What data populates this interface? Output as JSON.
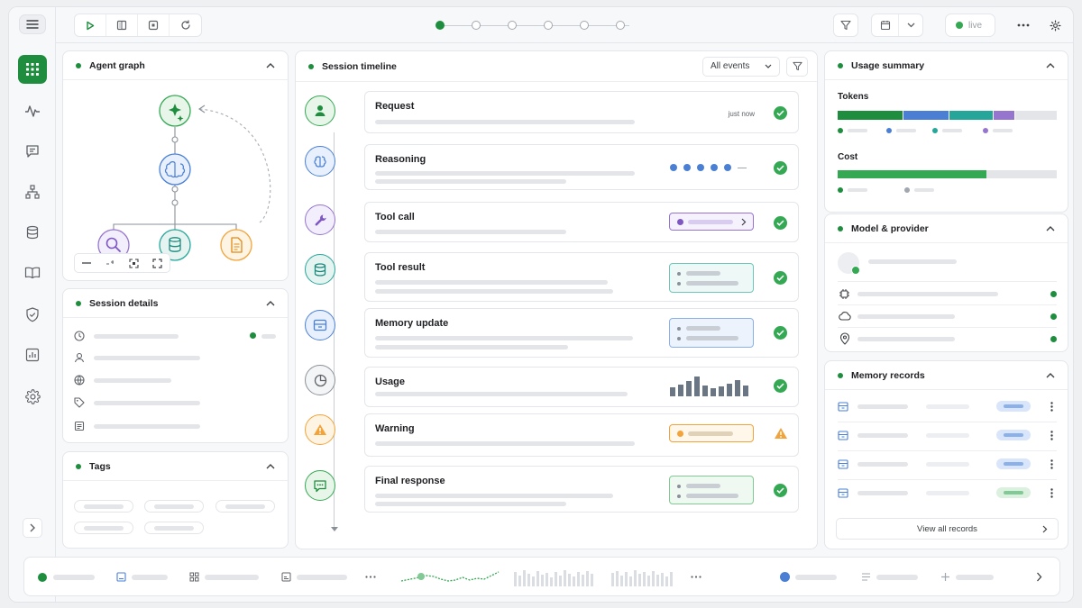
{
  "colors": {
    "green": "#1e8e3e",
    "blue": "#4a7fd4",
    "teal": "#26a69a",
    "purple": "#9575cd",
    "orange": "#f2a33a"
  },
  "sidebar": {
    "icons": [
      "apps-icon",
      "activity-icon",
      "chat-icon",
      "hierarchy-icon",
      "database-icon",
      "book-icon",
      "shield-icon",
      "report-icon",
      "gear-icon"
    ]
  },
  "topbar": {
    "live_label": "live",
    "progress_steps": 6,
    "active_step": 1
  },
  "agent_graph": {
    "title": "Agent graph"
  },
  "session_details": {
    "title": "Session details"
  },
  "tags": {
    "title": "Tags"
  },
  "timeline": {
    "title": "Session timeline",
    "filter_value": "All events",
    "events": [
      {
        "name": "Request",
        "status": "ok",
        "meta": "just now",
        "icon": "user-icon"
      },
      {
        "name": "Reasoning",
        "status": "ok",
        "icon": "brain-icon"
      },
      {
        "name": "Tool call",
        "status": "ok",
        "icon": "wrench-icon"
      },
      {
        "name": "Tool result",
        "status": "ok",
        "icon": "database-icon"
      },
      {
        "name": "Memory update",
        "status": "ok",
        "icon": "memory-icon"
      },
      {
        "name": "Usage",
        "status": "ok",
        "icon": "pie-icon"
      },
      {
        "name": "Warning",
        "status": "warning",
        "icon": "warning-icon"
      },
      {
        "name": "Final response",
        "status": "ok",
        "icon": "message-icon"
      }
    ],
    "usage_bars": [
      0.45,
      0.6,
      0.75,
      1.0,
      0.55,
      0.4,
      0.5,
      0.65,
      0.8,
      0.55
    ]
  },
  "usage_summary": {
    "title": "Usage summary",
    "tokens_label": "Tokens",
    "tokens_split": [
      0.3,
      0.21,
      0.2,
      0.1
    ],
    "cost_label": "Cost",
    "cost_fraction": 0.68
  },
  "model_provider": {
    "title": "Model & provider"
  },
  "memory_records": {
    "title": "Memory records",
    "view_all_label": "View all records"
  }
}
